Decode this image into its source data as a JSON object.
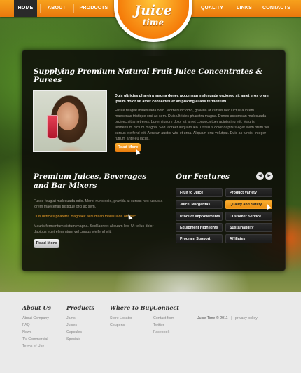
{
  "nav": {
    "items": [
      {
        "label": "HOME"
      },
      {
        "label": "ABOUT"
      },
      {
        "label": "PRODUCTS"
      },
      {
        "label": "QUALITY"
      },
      {
        "label": "LINKS"
      },
      {
        "label": "CONTACTS"
      }
    ],
    "active": "HOME"
  },
  "logo": {
    "line1": "Juice",
    "line2": "time"
  },
  "intro": {
    "title": "Supplying Premium Natural Fruit Juice Concentrates & Purees",
    "bold_text": "Duis ultricies pharetra magna donec accumsan malesuada orciosec sit amet eros orem ipsum dolor sit amet consectetuer adipiscing eliatis fermentum",
    "text": "Fusce feugiat malesuada odio. Morbi nunc odio, gravida at cursus nec luctus a lorem maecenas tristique orci ac sem. Duis ultricies pharetra magna. Donec accumsan malesuada orcinec sit amet eros. Lorem ipsum dolor sit amet consectetuer adipiscing elit. Mauris fermentum dictum magna. Sed laoreet aliquam leo. Ut tellus dolor dapibus eget elem ntum vel cursus eleifend elit. Aenean auctor wisi et urna. Aliquam erat volutpat. Duis ac turpis. Integer rutrum ante eu lacus.",
    "button": "Read More"
  },
  "juices": {
    "title": "Premium Juices, Beverages and Bar Mixers",
    "text1": "Fusce feugiat malesuada odio. Morbi nunc odio, gravida at cursus nec luctus a lorem maecenas tristique orci ac sem.",
    "link": "Duis ultricies pharetra magnaec accumsan malesuada orcinec",
    "text2": "Mauris fermentum dictum magna. Sed laoreet aliquam leo. Ut tellus dolor dapibus eget elem ntum vel cursus eleifend elit.",
    "button": "Read More"
  },
  "features": {
    "title": "Our Features",
    "prev_icon": "chevron-left-icon",
    "next_icon": "chevron-right-icon",
    "items": [
      {
        "label": "Fruit to Juice"
      },
      {
        "label": "Product Variety"
      },
      {
        "label": "Juice, Margaritas"
      },
      {
        "label": "Quality and Safety"
      },
      {
        "label": "Product Improvements"
      },
      {
        "label": "Customer Service"
      },
      {
        "label": "Equipment Highlights"
      },
      {
        "label": "Sustainability"
      },
      {
        "label": "Program Support"
      },
      {
        "label": "Affiliates"
      }
    ],
    "highlighted": "Quality and Safety"
  },
  "footer": {
    "columns": [
      {
        "title": "About Us",
        "links": [
          "About Company",
          "FAQ",
          "News",
          "TV Commercial",
          "Terms of Use"
        ]
      },
      {
        "title": "Products",
        "links": [
          "Jams",
          "Juices",
          "Capsules",
          "Specials"
        ]
      },
      {
        "title": "Where to Buy",
        "links": [
          "Store Locator",
          "Coupons"
        ]
      },
      {
        "title": "Connect",
        "links": [
          "Contact form",
          "Twitter",
          "Facebook"
        ]
      }
    ],
    "brand": "Juice Time",
    "copyright": "© 2011",
    "privacy": "privacy policy"
  },
  "colors": {
    "accent": "#f08a12",
    "panel": "#0c0a08",
    "footer": "#eaeaea"
  }
}
